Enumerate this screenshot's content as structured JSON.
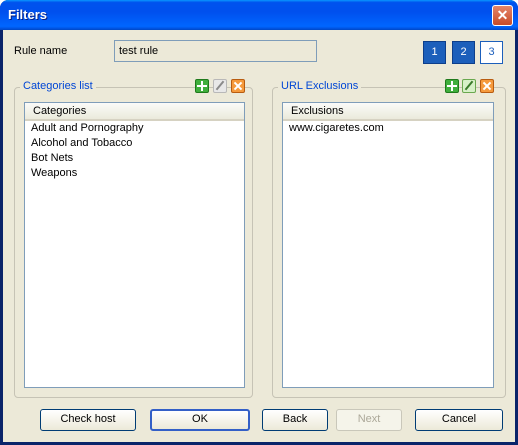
{
  "window": {
    "title": "Filters",
    "close_glyph": "✕"
  },
  "rule": {
    "label": "Rule name",
    "value": "test rule"
  },
  "pages": [
    "1",
    "2",
    "3"
  ],
  "active_pages": [
    "1",
    "2"
  ],
  "categories": {
    "group_label": "Categories list",
    "column_header": "Categories",
    "items": [
      "Adult and Pornography",
      "Alcohol and Tobacco",
      "Bot Nets",
      "Weapons"
    ],
    "tools": [
      "add-icon",
      "edit-icon (disabled)",
      "delete-icon"
    ]
  },
  "exclusions": {
    "group_label": "URL Exclusions",
    "column_header": "Exclusions",
    "items": [
      "www.cigaretes.com"
    ],
    "tools": [
      "add-icon",
      "edit-icon",
      "delete-icon"
    ]
  },
  "buttons": {
    "check_host": "Check host",
    "ok": "OK",
    "back": "Back",
    "next": "Next",
    "cancel": "Cancel"
  },
  "colors": {
    "accent": "#1c5fbb",
    "group_label": "#0046d5",
    "titlebar": "#0053ee",
    "face": "#ece9d8"
  }
}
